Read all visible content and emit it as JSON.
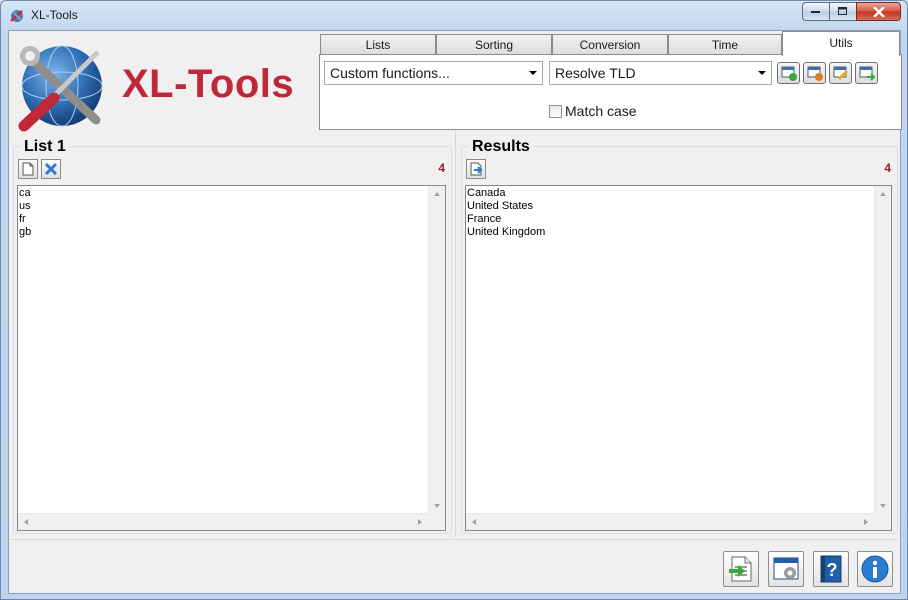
{
  "window": {
    "title": "XL-Tools"
  },
  "logo": {
    "text": "XL-Tools"
  },
  "tabs": [
    {
      "label": "Lists",
      "active": false
    },
    {
      "label": "Sorting",
      "active": false
    },
    {
      "label": "Conversion",
      "active": false
    },
    {
      "label": "Time",
      "active": false
    },
    {
      "label": "Utils",
      "active": true
    }
  ],
  "utils": {
    "function_select": "Custom functions...",
    "utility_select": "Resolve TLD",
    "match_case_label": "Match case",
    "match_case_checked": false
  },
  "list1": {
    "title": "List 1",
    "count": "4",
    "items": [
      "ca",
      "us",
      "fr",
      "gb"
    ]
  },
  "results": {
    "title": "Results",
    "count": "4",
    "items": [
      "Canada",
      "United States",
      "France",
      "United Kingdom"
    ]
  },
  "icons": {
    "toolbar": [
      "add-icon",
      "remove-icon",
      "edit-icon",
      "apply-icon"
    ],
    "bottom": [
      "export-icon",
      "settings-icon",
      "help-icon",
      "info-icon"
    ]
  },
  "colors": {
    "brand": "#c0283a",
    "count": "#a21a2a"
  }
}
